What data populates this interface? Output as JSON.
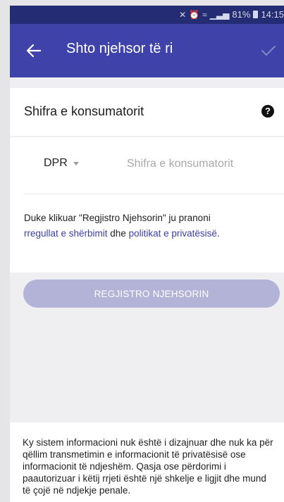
{
  "status_bar": {
    "battery": "81%",
    "time": "14:15"
  },
  "app_bar": {
    "title": "Shto njehsor të ri",
    "back_icon": "arrow-left-icon",
    "confirm_icon": "check-icon"
  },
  "section": {
    "title": "Shifra e konsumatorit",
    "help_icon": "?"
  },
  "form": {
    "prefix_selected": "DPR",
    "code_input_value": "",
    "code_input_placeholder": "Shifra e konsumatorit"
  },
  "terms": {
    "part1": "Duke klikuar \"Regjistro Njehsorin\" ju pranoni",
    "link1": "rregullat e shërbimit",
    "part2": " dhe ",
    "link2": "politikat e privatësisë",
    "part3": "."
  },
  "register_button": {
    "label": "REGJISTRO NJEHSORIN"
  },
  "footer": {
    "disclaimer": "Ky sistem informacioni nuk është i dizajnuar dhe nuk ka për qëllim transmetimin e informacionit të privatësisë ose informacionit të ndjeshëm. Qasja ose përdorimi i paautorizuar i këtij rrjeti është një shkelje e ligjit dhe mund të çojë në ndjekje penale."
  },
  "colors": {
    "status_bar": "#242c74",
    "app_bar": "#3f42a8",
    "link": "#3c3fa4",
    "button_disabled": "#b2b3d7",
    "background": "#efeff2"
  }
}
